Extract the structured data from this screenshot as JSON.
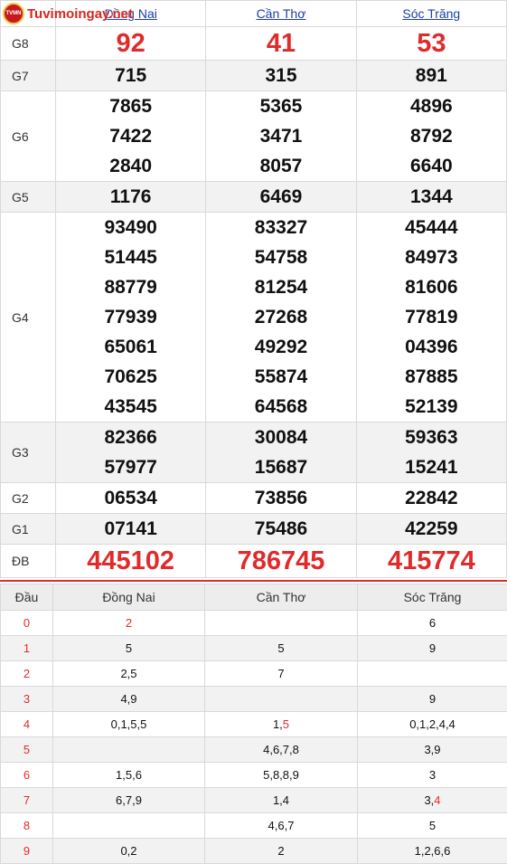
{
  "brand": {
    "name": "Tuvimoingay.net",
    "badge": "TVMN"
  },
  "provinces": [
    "Đồng Nai",
    "Cần Thơ",
    "Sóc Trăng"
  ],
  "prizes": [
    {
      "label": "G8",
      "values": [
        [
          "92"
        ],
        [
          "41"
        ],
        [
          "53"
        ]
      ]
    },
    {
      "label": "G7",
      "values": [
        [
          "715"
        ],
        [
          "315"
        ],
        [
          "891"
        ]
      ]
    },
    {
      "label": "G6",
      "values": [
        [
          "7865",
          "7422",
          "2840"
        ],
        [
          "5365",
          "3471",
          "8057"
        ],
        [
          "4896",
          "8792",
          "6640"
        ]
      ]
    },
    {
      "label": "G5",
      "values": [
        [
          "1176"
        ],
        [
          "6469"
        ],
        [
          "1344"
        ]
      ]
    },
    {
      "label": "G4",
      "values": [
        [
          "93490",
          "51445",
          "88779",
          "77939",
          "65061",
          "70625",
          "43545"
        ],
        [
          "83327",
          "54758",
          "81254",
          "27268",
          "49292",
          "55874",
          "64568"
        ],
        [
          "45444",
          "84973",
          "81606",
          "77819",
          "04396",
          "87885",
          "52139"
        ]
      ]
    },
    {
      "label": "G3",
      "values": [
        [
          "82366",
          "57977"
        ],
        [
          "30084",
          "15687"
        ],
        [
          "59363",
          "15241"
        ]
      ]
    },
    {
      "label": "G2",
      "values": [
        [
          "06534"
        ],
        [
          "73856"
        ],
        [
          "22842"
        ]
      ]
    },
    {
      "label": "G1",
      "values": [
        [
          "07141"
        ],
        [
          "75486"
        ],
        [
          "42259"
        ]
      ]
    },
    {
      "label": "ĐB",
      "values": [
        [
          "445102"
        ],
        [
          "786745"
        ],
        [
          "415774"
        ]
      ]
    }
  ],
  "loto": {
    "header": [
      "Đầu",
      "Đồng Nai",
      "Cần Thơ",
      "Sóc Trăng"
    ],
    "rows": [
      {
        "dau": "0",
        "cells": [
          {
            "text": "2",
            "hl": ""
          },
          {
            "text": "",
            "hl": ""
          },
          {
            "text": "6",
            "hl": ""
          }
        ]
      },
      {
        "dau": "1",
        "cells": [
          {
            "text": "5",
            "hl": ""
          },
          {
            "text": "5",
            "hl": ""
          },
          {
            "text": "9",
            "hl": ""
          }
        ]
      },
      {
        "dau": "2",
        "cells": [
          {
            "text": "2,5",
            "hl": ""
          },
          {
            "text": "7",
            "hl": ""
          },
          {
            "text": "",
            "hl": ""
          }
        ]
      },
      {
        "dau": "3",
        "cells": [
          {
            "text": "4,9",
            "hl": ""
          },
          {
            "text": "",
            "hl": ""
          },
          {
            "text": "9",
            "hl": ""
          }
        ]
      },
      {
        "dau": "4",
        "cells": [
          {
            "text": "0,1,5,5",
            "hl": ""
          },
          {
            "text": "1,",
            "hl": "5"
          },
          {
            "text": "0,1,2,4,4",
            "hl": ""
          }
        ]
      },
      {
        "dau": "5",
        "cells": [
          {
            "text": "",
            "hl": ""
          },
          {
            "text": "4,6,7,8",
            "hl": ""
          },
          {
            "text": "3,9",
            "hl": ""
          }
        ]
      },
      {
        "dau": "6",
        "cells": [
          {
            "text": "1,5,6",
            "hl": ""
          },
          {
            "text": "5,8,8,9",
            "hl": ""
          },
          {
            "text": "3",
            "hl": ""
          }
        ]
      },
      {
        "dau": "7",
        "cells": [
          {
            "text": "6,7,9",
            "hl": ""
          },
          {
            "text": "1,4",
            "hl": ""
          },
          {
            "text": "3,",
            "hl": "4"
          }
        ]
      },
      {
        "dau": "8",
        "cells": [
          {
            "text": "",
            "hl": ""
          },
          {
            "text": "4,6,7",
            "hl": ""
          },
          {
            "text": "5",
            "hl": ""
          }
        ]
      },
      {
        "dau": "9",
        "cells": [
          {
            "text": "0,2",
            "hl": ""
          },
          {
            "text": "2",
            "hl": ""
          },
          {
            "text": "1,2,6,6",
            "hl": ""
          }
        ]
      }
    ]
  },
  "colors": {
    "accent": "#e12b2b",
    "link": "#1a3fa8"
  }
}
